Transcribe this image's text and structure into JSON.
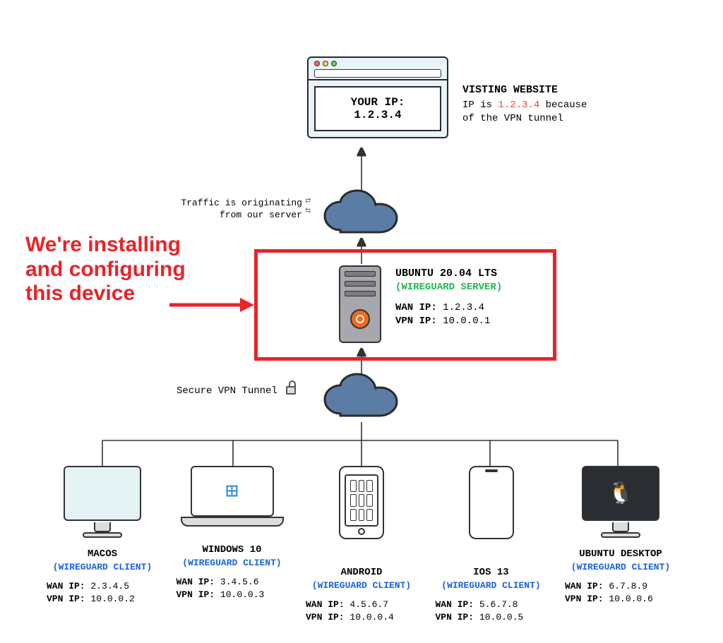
{
  "browser": {
    "line1": "YOUR IP:",
    "line2": "1.2.3.4"
  },
  "website_note": {
    "title": "VISTING WEBSITE",
    "line_prefix": "IP is ",
    "ip": "1.2.3.4",
    "line_suffix": " because",
    "line2": "of the VPN tunnel"
  },
  "traffic": {
    "line1": "Traffic is originating",
    "line2": "from our server"
  },
  "callout": {
    "line1": "We're installing",
    "line2": "and configuring",
    "line3": "this device"
  },
  "server": {
    "os": "UBUNTU 20.04 LTS",
    "role": "(WIREGUARD SERVER)",
    "wan_label": "WAN IP:",
    "wan": "1.2.3.4",
    "vpn_label": "VPN IP:",
    "vpn": "10.0.0.1"
  },
  "tunnel_label": "Secure VPN Tunnel",
  "client_role": "(WIREGUARD CLIENT)",
  "wan_label": "WAN IP:",
  "vpn_label": "VPN IP:",
  "clients": [
    {
      "name": "MACOS",
      "wan": "2.3.4.5",
      "vpn": "10.0.0.2"
    },
    {
      "name": "WINDOWS 10",
      "wan": "3.4.5.6",
      "vpn": "10.0.0.3"
    },
    {
      "name": "ANDROID",
      "wan": "4.5.6.7",
      "vpn": "10.0.0.4"
    },
    {
      "name": "IOS 13",
      "wan": "5.6.7.8",
      "vpn": "10.0.0.5"
    },
    {
      "name": "UBUNTU DESKTOP",
      "wan": "6.7.8.9",
      "vpn": "10.0.0.6"
    }
  ]
}
